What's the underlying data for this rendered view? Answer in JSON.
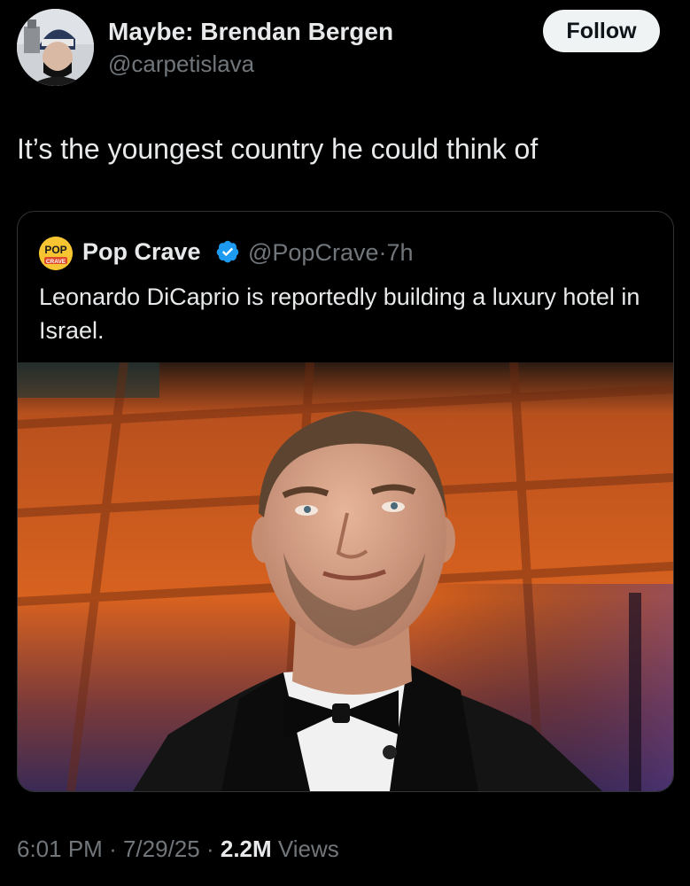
{
  "tweet": {
    "author_name": "Maybe: Brendan Bergen",
    "author_handle": "@carpetislava",
    "follow_label": "Follow",
    "text": "It’s the youngest country he could think of"
  },
  "quoted": {
    "logo_text_top": "POP",
    "logo_text_bottom": "CRAVE",
    "name": "Pop Crave",
    "handle": "@PopCrave",
    "separator": "·",
    "age": "7h",
    "text": "Leonardo DiCaprio is reportedly building a luxury hotel in Israel."
  },
  "meta": {
    "time": "6:01 PM",
    "date": "7/29/25",
    "views_count": "2.2M",
    "views_label": "Views",
    "separator": "·"
  },
  "colors": {
    "background": "#000000",
    "primary_text": "#e7e9ea",
    "secondary_text": "#71767b",
    "verified": "#1d9bf0",
    "border": "#2f3336"
  }
}
